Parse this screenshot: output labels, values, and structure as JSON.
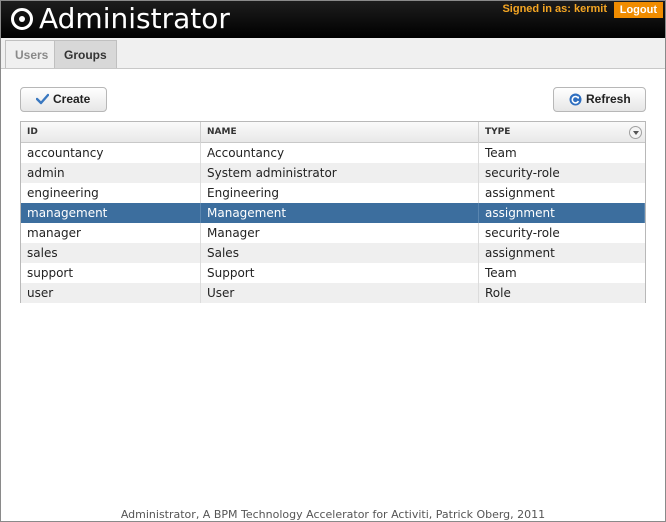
{
  "header": {
    "app_title": "Administrator",
    "signed_in_text": "Signed in as: kermit",
    "logout_label": "Logout"
  },
  "tabs": [
    {
      "label": "Users",
      "active": false
    },
    {
      "label": "Groups",
      "active": true
    }
  ],
  "toolbar": {
    "create_label": "Create",
    "refresh_label": "Refresh"
  },
  "table": {
    "columns": [
      "ID",
      "NAME",
      "TYPE"
    ],
    "selected_row": 3,
    "rows": [
      {
        "id": "accountancy",
        "name": "Accountancy",
        "type": "Team"
      },
      {
        "id": "admin",
        "name": "System administrator",
        "type": "security-role"
      },
      {
        "id": "engineering",
        "name": "Engineering",
        "type": "assignment"
      },
      {
        "id": "management",
        "name": "Management",
        "type": "assignment"
      },
      {
        "id": "manager",
        "name": "Manager",
        "type": "security-role"
      },
      {
        "id": "sales",
        "name": "Sales",
        "type": "assignment"
      },
      {
        "id": "support",
        "name": "Support",
        "type": "Team"
      },
      {
        "id": "user",
        "name": "User",
        "type": "Role"
      }
    ]
  },
  "footer": {
    "text": "Administrator, A BPM Technology Accelerator for Activiti, Patrick Oberg, 2011"
  },
  "icons": {
    "logo": "target-logo-icon",
    "create": "checkmark-icon",
    "refresh": "refresh-icon",
    "column_menu": "chevron-down-icon"
  },
  "colors": {
    "header_bg": "#000000",
    "signed_in": "#f5a623",
    "logout_bg": "#f08c00",
    "selected_row": "#3c6e9e"
  }
}
